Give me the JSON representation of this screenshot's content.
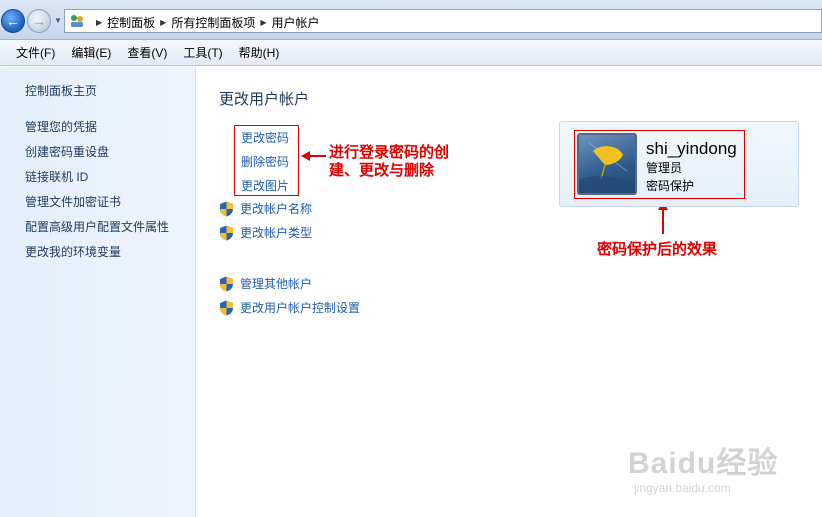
{
  "breadcrumb": [
    "控制面板",
    "所有控制面板项",
    "用户帐户"
  ],
  "menu": [
    "文件(F)",
    "编辑(E)",
    "查看(V)",
    "工具(T)",
    "帮助(H)"
  ],
  "sidebar": {
    "home": "控制面板主页",
    "links": [
      "管理您的凭据",
      "创建密码重设盘",
      "链接联机 ID",
      "管理文件加密证书",
      "配置高级用户配置文件属性",
      "更改我的环境变量"
    ]
  },
  "main": {
    "title": "更改用户帐户",
    "password_links": [
      "更改密码",
      "删除密码",
      "更改图片"
    ],
    "task_links": [
      "更改帐户名称",
      "更改帐户类型"
    ],
    "other_links": [
      "管理其他帐户",
      "更改用户帐户控制设置"
    ]
  },
  "account": {
    "name": "shi_yindong",
    "role": "管理员",
    "status": "密码保护"
  },
  "annotations": {
    "password_note_line1": "进行登录密码的创",
    "password_note_line2": "建、更改与删除",
    "effect_note": "密码保护后的效果"
  },
  "watermark": {
    "brand": "Baidu经验",
    "url": "jingyan.baidu.com"
  },
  "colors": {
    "link": "#1f5ea8",
    "annotation": "#e00000",
    "sidebar_bg": "#e5effa"
  }
}
